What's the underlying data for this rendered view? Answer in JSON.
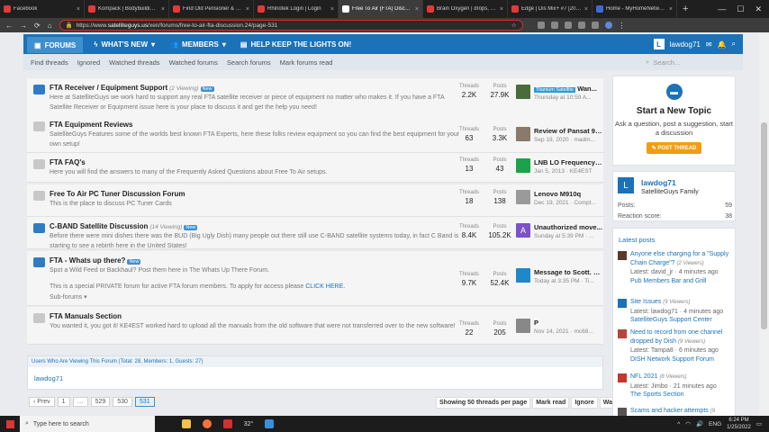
{
  "browser": {
    "tabs": [
      {
        "label": "Facebook",
        "color": "#e53935",
        "active": false
      },
      {
        "label": "Kompack | Bodybuilding.com",
        "color": "#e53935",
        "active": false
      },
      {
        "label": "Find Old Pensioner & Single...",
        "color": "#e53935",
        "active": false
      },
      {
        "label": "Rhinotek Login | Login",
        "color": "#e53935",
        "active": false
      },
      {
        "label": "Free To Air (FTA) Discussion |",
        "color": "#ffffff",
        "active": true
      },
      {
        "label": "Brain Oxygen | drops, switch...",
        "color": "#e53935",
        "active": false
      },
      {
        "label": "Edge | Dis Mix+ #7 [2020-21]...",
        "color": "#e53935",
        "active": false
      },
      {
        "label": "Home - MyHomeNetwork - YL...",
        "color": "#3d6bd6",
        "active": false
      }
    ],
    "new_tab": "+",
    "url_prefix": "https://www.",
    "url_host": "satelliteguys.us",
    "url_path": "/xen/forums/free-to-air-fta-discussion.24/page-531"
  },
  "site_nav": {
    "items": [
      {
        "label": "FORUMS",
        "icon": "chat-icon",
        "active": true
      },
      {
        "label": "WHAT'S NEW",
        "icon": "bolt-icon",
        "active": false
      },
      {
        "label": "MEMBERS",
        "icon": "users-icon",
        "active": false
      },
      {
        "label": "HELP KEEP THE LIGHTS ON!",
        "icon": "bill-icon",
        "active": false
      }
    ],
    "user_initial": "L",
    "username": "lawdog71"
  },
  "sub_nav": {
    "items": [
      "Find threads",
      "Ignored",
      "Watched threads",
      "Watched forums",
      "Search forums",
      "Mark forums read"
    ],
    "search_placeholder": "Search..."
  },
  "labels": {
    "threads": "Threads",
    "posts": "Posts",
    "new": "New"
  },
  "forums": [
    {
      "title": "FTA Receiver / Equipment Support",
      "viewing": "(2 Viewing)",
      "is_new": true,
      "desc": "Here at SatelliteGuys we work hard to support any real FTA satellite receiver or piece of equipment no matter who makes it. If you have a FTA Satellite Receiver or Equipment issue here is your place to discuss it and get the help you need!",
      "threads": "2.2K",
      "posts": "27.9K",
      "last_prefix": "Titanium Satellite",
      "last_title": "Wan...",
      "last_meta": "Thursday at 10:59 A...",
      "avatar_color": "#4a6b3a"
    },
    {
      "title": "FTA Equipment Reviews",
      "viewing": "",
      "is_new": false,
      "desc": "SatelliteGuys Features some of the worlds best known FTA Experts, here these folks review equipment so you can find the best equipment for your own setup!",
      "threads": "63",
      "posts": "3.3K",
      "last_prefix": "",
      "last_title": "Review of Pansat 95...",
      "last_meta": "Sep 19, 2020 · madm...",
      "avatar_color": "#8a7a6a"
    },
    {
      "title": "FTA FAQ's",
      "viewing": "",
      "is_new": false,
      "desc": "Here you will find the answers to many of the Frequently Asked Questions about Free To Air setups.",
      "threads": "13",
      "posts": "43",
      "last_prefix": "",
      "last_title": "LNB LO Frequency - ...",
      "last_meta": "Jan 5, 2013 · KE4EST",
      "avatar_color": "#1aa34a"
    },
    {
      "title": "Free To Air PC Tuner Discussion Forum",
      "viewing": "",
      "is_new": false,
      "desc": "This is the place to discuss PC Tuner Cards",
      "threads": "18",
      "posts": "138",
      "last_prefix": "",
      "last_title": "Lenovo M910q",
      "last_meta": "Dec 19, 2021 · Compt...",
      "avatar_color": "#9a9a9a"
    },
    {
      "title": "C-BAND Satellite Discussion",
      "viewing": "(14 Viewing)",
      "is_new": true,
      "desc": "Before there were mini dishes there was the BUD (Big Ugly Dish) many people out there still use C-BAND satellite systems today, in fact C Band is starting to see a rebirth here in the United States!",
      "threads": "8.4K",
      "posts": "105.2K",
      "last_prefix": "",
      "last_title": "Unauthorized move...",
      "last_meta": "Sunday at 5:39 PM · ...",
      "avatar_color": "#7b52c9",
      "avatar_letter": "A"
    },
    {
      "title": "FTA - Whats up there?",
      "viewing": "",
      "is_new": true,
      "desc": "Spot a Wild Feed or Backhaul? Post them here in The Whats Up There Forum.",
      "desc2": "This is a special PRIVATE forum for active FTA forum members. To apply for access please ",
      "desc2_link": "CLICK HERE.",
      "subforums": "Sub-forums",
      "threads": "9.7K",
      "posts": "52.4K",
      "last_prefix": "",
      "last_title": "Message to Scott. D...",
      "last_meta": "Today at 3:35 PM · Ti...",
      "avatar_color": "#1e88c9"
    },
    {
      "title": "FTA Manuals Section",
      "viewing": "",
      "is_new": false,
      "desc": "You wanted it, you got it! KE4EST worked hard to upload all the manuals from the old software that were not transferred over to the new software!",
      "threads": "22",
      "posts": "205",
      "last_prefix": "",
      "last_title": "P",
      "last_meta": "Nov 14, 2021 · mc68...",
      "avatar_color": "#888888"
    }
  ],
  "viewing_block": {
    "header": "Users Who Are Viewing This Forum (Total: 28, Members: 1, Guests: 27)",
    "user": "lawdog71"
  },
  "pagination": {
    "prev": "‹ Prev",
    "pages": [
      "1",
      "…",
      "529",
      "530",
      "531"
    ],
    "current": "531"
  },
  "bottom_buttons": [
    "Showing 50 threads per page",
    "Mark read",
    "Ignore",
    "Watch"
  ],
  "new_topic": {
    "title": "Start a New Topic",
    "desc": "Ask a question, post a suggestion, start a discussion",
    "button": "POST THREAD"
  },
  "profile": {
    "initial": "L",
    "name": "lawdog71",
    "group": "SatelliteGuys Family",
    "posts_label": "Posts:",
    "posts": "59",
    "reaction_label": "Reaction score:",
    "reaction": "38"
  },
  "latest_posts": {
    "header": "Latest posts",
    "items": [
      {
        "title": "Anyone else charging for a \"Supply Chain Charge\"?",
        "viewers": "(2 Viewers)",
        "meta": "Latest: david_jr · 4 minutes ago",
        "forum": "Pub Members Bar and Grill",
        "color": "#5a3a2a"
      },
      {
        "title": "Site Issues",
        "viewers": "(9 Viewers)",
        "meta": "Latest: lawdog71 · 4 minutes ago",
        "forum": "SatelliteGuys Support Center",
        "color": "#1b72b8"
      },
      {
        "title": "Need to record from one channel dropped by Dish",
        "viewers": "(9 Viewers)",
        "meta": "Latest: Tampa8 · 6 minutes ago",
        "forum": "DISH Network Support Forum",
        "color": "#b8453a"
      },
      {
        "title": "NFL 2021",
        "viewers": "(8 Viewers)",
        "meta": "Latest: Jimbo · 21 minutes ago",
        "forum": "The Sports Section",
        "color": "#c0392b"
      },
      {
        "title": "Scams and hacker attempts",
        "viewers": "(9 Viewers)",
        "meta": "",
        "forum": "",
        "color": "#555555"
      }
    ]
  },
  "taskbar": {
    "search_placeholder": "Type here to search",
    "weather": "32°",
    "lang": "ENG",
    "time": "6:24 PM",
    "date": "1/25/2022"
  }
}
